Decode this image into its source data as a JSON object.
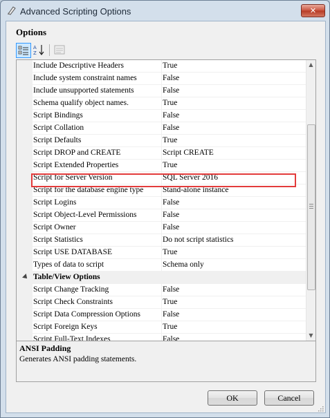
{
  "window": {
    "title": "Advanced Scripting Options"
  },
  "section_title": "Options",
  "rows": [
    {
      "type": "prop",
      "name": "Include Descriptive Headers",
      "value": "True"
    },
    {
      "type": "prop",
      "name": "Include system constraint names",
      "value": "False"
    },
    {
      "type": "prop",
      "name": "Include unsupported statements",
      "value": "False"
    },
    {
      "type": "prop",
      "name": "Schema qualify object names.",
      "value": "True"
    },
    {
      "type": "prop",
      "name": "Script Bindings",
      "value": "False"
    },
    {
      "type": "prop",
      "name": "Script Collation",
      "value": "False"
    },
    {
      "type": "prop",
      "name": "Script Defaults",
      "value": "True"
    },
    {
      "type": "prop",
      "name": "Script DROP and CREATE",
      "value": "Script CREATE"
    },
    {
      "type": "prop",
      "name": "Script Extended Properties",
      "value": "True"
    },
    {
      "type": "prop",
      "name": "Script for Server Version",
      "value": "SQL Server 2016",
      "highlighted": true
    },
    {
      "type": "prop",
      "name": "Script for the database engine type",
      "value": "Stand-alone instance"
    },
    {
      "type": "prop",
      "name": "Script Logins",
      "value": "False"
    },
    {
      "type": "prop",
      "name": "Script Object-Level Permissions",
      "value": "False"
    },
    {
      "type": "prop",
      "name": "Script Owner",
      "value": "False"
    },
    {
      "type": "prop",
      "name": "Script Statistics",
      "value": "Do not script statistics"
    },
    {
      "type": "prop",
      "name": "Script USE DATABASE",
      "value": "True"
    },
    {
      "type": "prop",
      "name": "Types of data to script",
      "value": "Schema only"
    },
    {
      "type": "category",
      "name": "Table/View Options",
      "value": ""
    },
    {
      "type": "prop",
      "name": "Script Change Tracking",
      "value": "False"
    },
    {
      "type": "prop",
      "name": "Script Check Constraints",
      "value": "True"
    },
    {
      "type": "prop",
      "name": "Script Data Compression Options",
      "value": "False"
    },
    {
      "type": "prop",
      "name": "Script Foreign Keys",
      "value": "True"
    },
    {
      "type": "prop",
      "name": "Script Full-Text Indexes",
      "value": "False"
    }
  ],
  "description": {
    "title": "ANSI Padding",
    "text": "Generates ANSI padding statements."
  },
  "buttons": {
    "ok": "OK",
    "cancel": "Cancel"
  },
  "icons": {
    "app": "script-options-icon",
    "categorized": "categorized-icon",
    "alphabetical": "sort-alphabetical-icon",
    "property_pages": "property-pages-icon",
    "close": "close-icon"
  },
  "colors": {
    "highlight": "#e33b3b",
    "category_bg": "#f0f0f0"
  }
}
